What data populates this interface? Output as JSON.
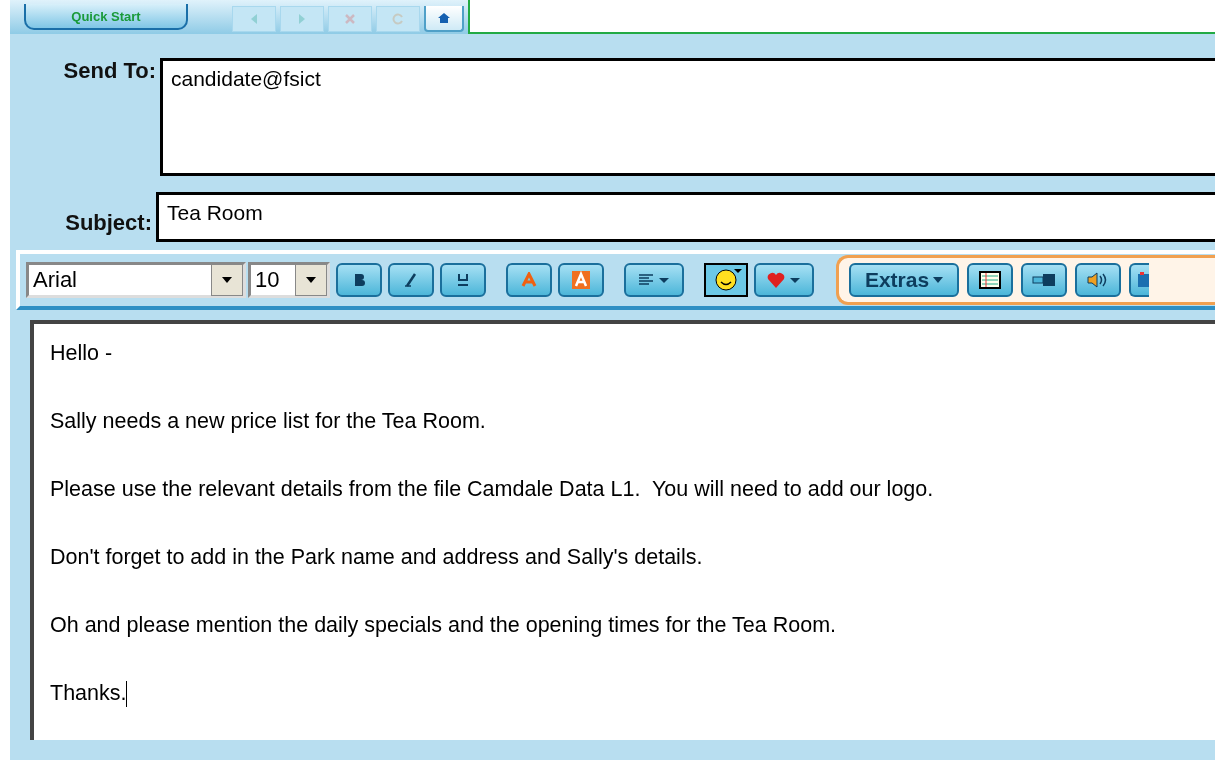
{
  "toolbar": {
    "quick_start": "Quick Start",
    "nav_buttons": [
      {
        "kind": "back",
        "disabled": true
      },
      {
        "kind": "forward",
        "disabled": true
      },
      {
        "kind": "stop",
        "disabled": true
      },
      {
        "kind": "refresh",
        "disabled": true
      },
      {
        "kind": "home",
        "disabled": false
      }
    ]
  },
  "send_to": {
    "label": "Send To:",
    "value": "candidate@fsict"
  },
  "subject": {
    "label": "Subject:",
    "value": "Tea Room"
  },
  "format": {
    "font": "Arial",
    "size": "10",
    "extras": "Extras"
  },
  "message": [
    "Hello -",
    "Sally needs a new price list for the Tea Room.",
    "Please use the relevant details from the file Camdale Data L1.  You will need to add our logo.",
    "Don't forget to add in the Park name and address and Sally's details.",
    "Oh and please mention the daily specials and the opening times for the Tea Room.",
    "Thanks."
  ]
}
